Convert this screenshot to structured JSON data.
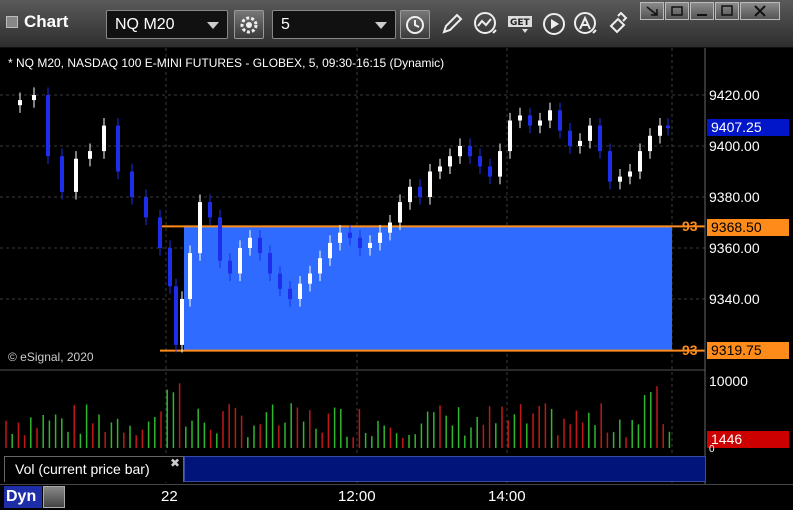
{
  "toolbar": {
    "title": "Chart",
    "symbol": "NQ M20",
    "interval": "5"
  },
  "chart": {
    "description": "* NQ M20, NASDAQ 100 E-MINI FUTURES - GLOBEX, 5, 09:30-16:15 (Dynamic)",
    "copyright": "© eSignal, 2020",
    "price_axis_labels": [
      "9420.00",
      "9400.00",
      "9380.00",
      "9360.00",
      "9340.00"
    ],
    "current_price": "9407.25",
    "upper_level": {
      "price": "9368.50",
      "label": "93"
    },
    "lower_level": {
      "price": "9319.75",
      "label": "93"
    },
    "time_labels": [
      "22",
      "12:00",
      "14:00"
    ],
    "colors": {
      "up": "#ffffff",
      "down": "#1d2eea",
      "band": "#2f6bff",
      "level": "#ff8c1a",
      "current": "#0016c8",
      "vol_tag": "#cc0000"
    }
  },
  "volume": {
    "study_label": "Vol (current price bar)",
    "axis_top": "10000",
    "current": "1446",
    "axis_bottom": "0"
  },
  "footer": {
    "mode": "Dyn"
  }
}
